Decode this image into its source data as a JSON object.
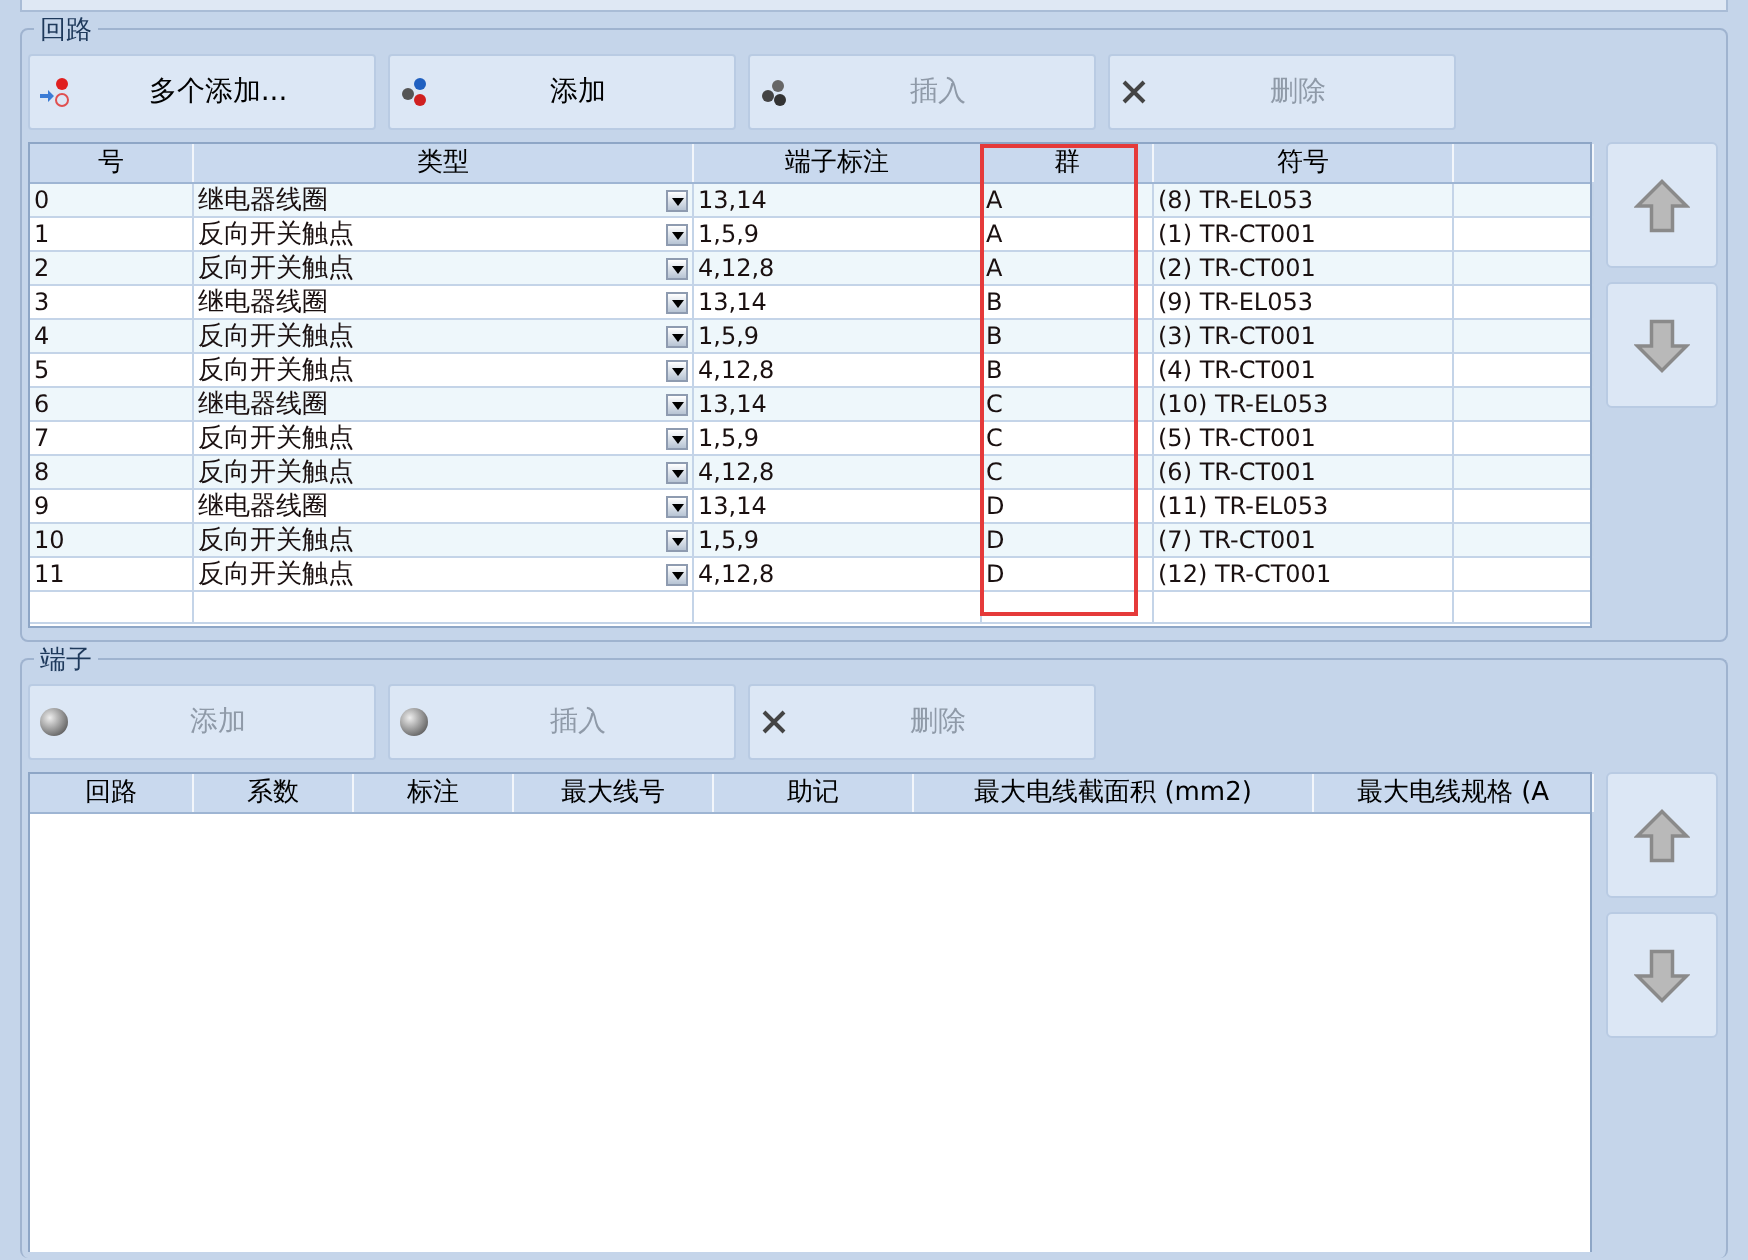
{
  "circuits": {
    "title": "回路",
    "buttons": [
      {
        "label": "多个添加...",
        "kind": "multi",
        "enabled": true
      },
      {
        "label": "添加",
        "kind": "molecule",
        "enabled": true
      },
      {
        "label": "插入",
        "kind": "cluster",
        "enabled": false
      },
      {
        "label": "删除",
        "kind": "cross",
        "enabled": false
      }
    ],
    "table": {
      "columns": [
        {
          "label": "号"
        },
        {
          "label": "类型"
        },
        {
          "label": "端子标注"
        },
        {
          "label": "群",
          "highlighted": true
        },
        {
          "label": "符号"
        }
      ],
      "rows": [
        {
          "cells": [
            "0",
            "继电器线圈",
            "13,14",
            "A",
            "(8) TR-EL053"
          ]
        },
        {
          "cells": [
            "1",
            "反向开关触点",
            "1,5,9",
            "A",
            "(1) TR-CT001"
          ]
        },
        {
          "cells": [
            "2",
            "反向开关触点",
            "4,12,8",
            "A",
            "(2) TR-CT001"
          ]
        },
        {
          "cells": [
            "3",
            "继电器线圈",
            "13,14",
            "B",
            "(9) TR-EL053"
          ]
        },
        {
          "cells": [
            "4",
            "反向开关触点",
            "1,5,9",
            "B",
            "(3) TR-CT001"
          ]
        },
        {
          "cells": [
            "5",
            "反向开关触点",
            "4,12,8",
            "B",
            "(4) TR-CT001"
          ]
        },
        {
          "cells": [
            "6",
            "继电器线圈",
            "13,14",
            "C",
            "(10) TR-EL053"
          ]
        },
        {
          "cells": [
            "7",
            "反向开关触点",
            "1,5,9",
            "C",
            "(5) TR-CT001"
          ]
        },
        {
          "cells": [
            "8",
            "反向开关触点",
            "4,12,8",
            "C",
            "(6) TR-CT001"
          ]
        },
        {
          "cells": [
            "9",
            "继电器线圈",
            "13,14",
            "D",
            "(11) TR-EL053"
          ]
        },
        {
          "cells": [
            "10",
            "反向开关触点",
            "1,5,9",
            "D",
            "(7) TR-CT001"
          ]
        },
        {
          "cells": [
            "11",
            "反向开关触点",
            "4,12,8",
            "D",
            "(12) TR-CT001"
          ]
        }
      ]
    }
  },
  "terminals": {
    "title": "端子",
    "buttons": [
      {
        "label": "添加",
        "kind": "ball",
        "enabled": false
      },
      {
        "label": "插入",
        "kind": "ball",
        "enabled": false
      },
      {
        "label": "删除",
        "kind": "cross",
        "enabled": false
      }
    ],
    "table": {
      "columns": [
        "回路",
        "系数",
        "标注",
        "最大线号",
        "助记",
        "最大电线截面积 (mm2)",
        "最大电线规格 (A"
      ]
    }
  }
}
